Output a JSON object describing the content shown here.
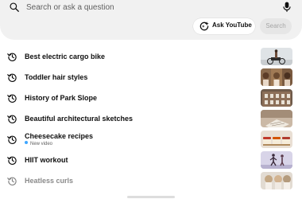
{
  "search": {
    "placeholder": "Search or ask a question",
    "ask_label": "Ask YouTube",
    "search_label": "Search"
  },
  "suggestions": [
    {
      "label": "Best electric cargo bike",
      "sub": ""
    },
    {
      "label": "Toddler hair styles",
      "sub": ""
    },
    {
      "label": "History of Park Slope",
      "sub": ""
    },
    {
      "label": "Beautiful architectural sketches",
      "sub": ""
    },
    {
      "label": "Cheesecake recipes",
      "sub": "New video"
    },
    {
      "label": "HIIT workout",
      "sub": ""
    },
    {
      "label": "Heatless curls",
      "sub": ""
    }
  ],
  "icons": {
    "search": "search-icon",
    "mic": "microphone-icon",
    "ask": "ai-sparkle-icon",
    "history": "history-icon"
  },
  "colors": {
    "panel": "#f1f1f1",
    "new_dot": "#3ea6ff",
    "search_button_bg": "#e6e6e6"
  }
}
